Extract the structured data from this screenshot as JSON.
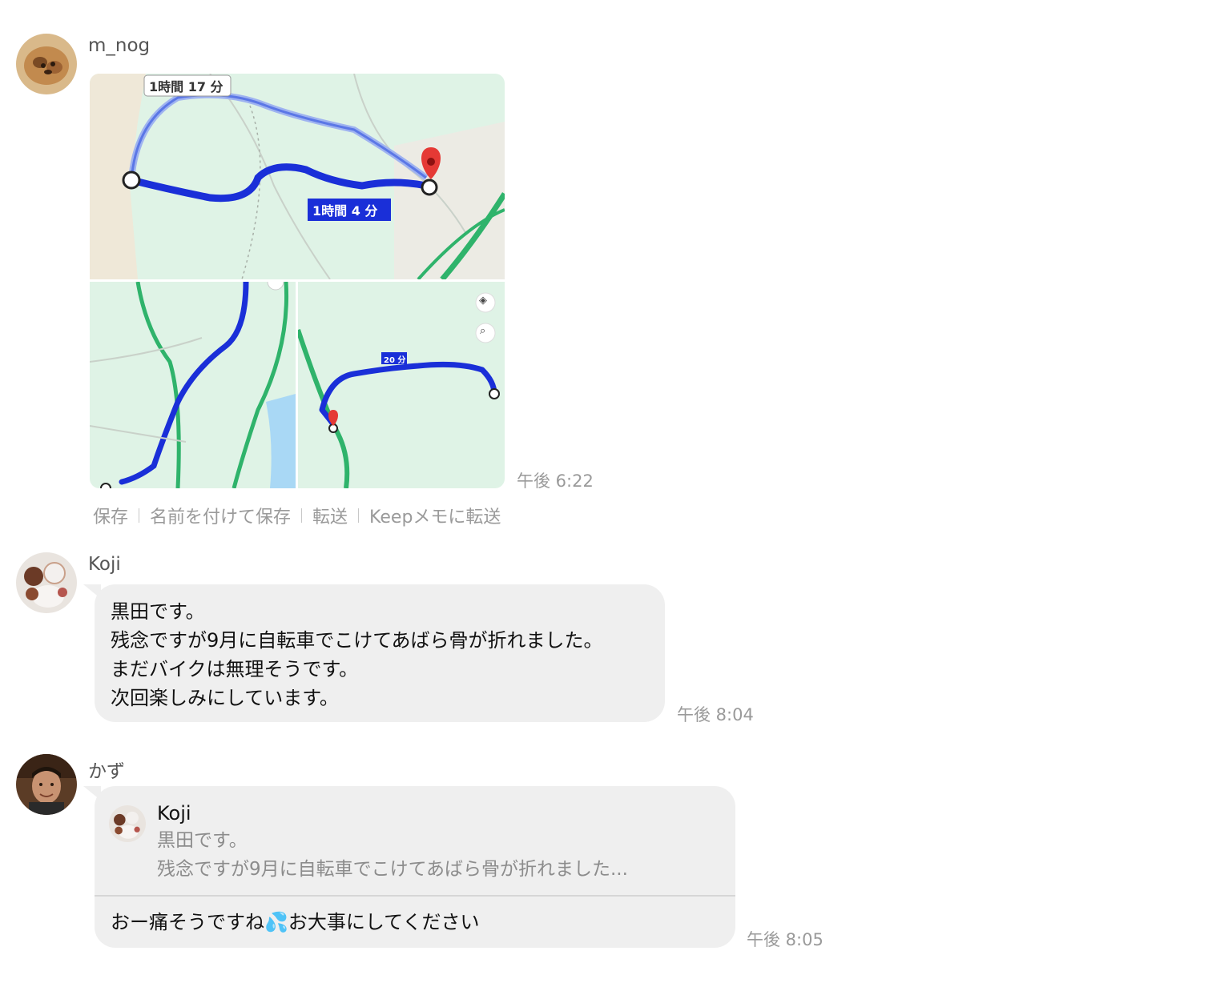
{
  "messages": {
    "m1": {
      "sender": "m_nog",
      "time": "午後 6:22",
      "map": {
        "route_badge_gray": "1時間 17 分",
        "route_badge_blue": "1時間 4 分",
        "small_badge": "20 分"
      },
      "actions": [
        "保存",
        "名前を付けて保存",
        "転送",
        "Keepメモに転送"
      ]
    },
    "m2": {
      "sender": "Koji",
      "time": "午後 8:04",
      "lines": [
        "黒田です。",
        "残念ですが9月に自転車でこけてあばら骨が折れました。",
        "まだバイクは無理そうです。",
        "次回楽しみにしています。"
      ]
    },
    "m3": {
      "sender": "かず",
      "time": "午後 8:05",
      "quote": {
        "name": "Koji",
        "line1": "黒田です。",
        "line2": "残念ですが9月に自転車でこけてあばら骨が折れました..."
      },
      "reply_before_emoji": "おー痛そうですね",
      "reply_emoji": "💦",
      "reply_after_emoji": "お大事にしてください"
    }
  },
  "colors": {
    "bubble": "#efefef",
    "timestamp": "#9a9a9a",
    "route_blue": "#1a2fd8",
    "map_green": "#d9f3e3"
  }
}
